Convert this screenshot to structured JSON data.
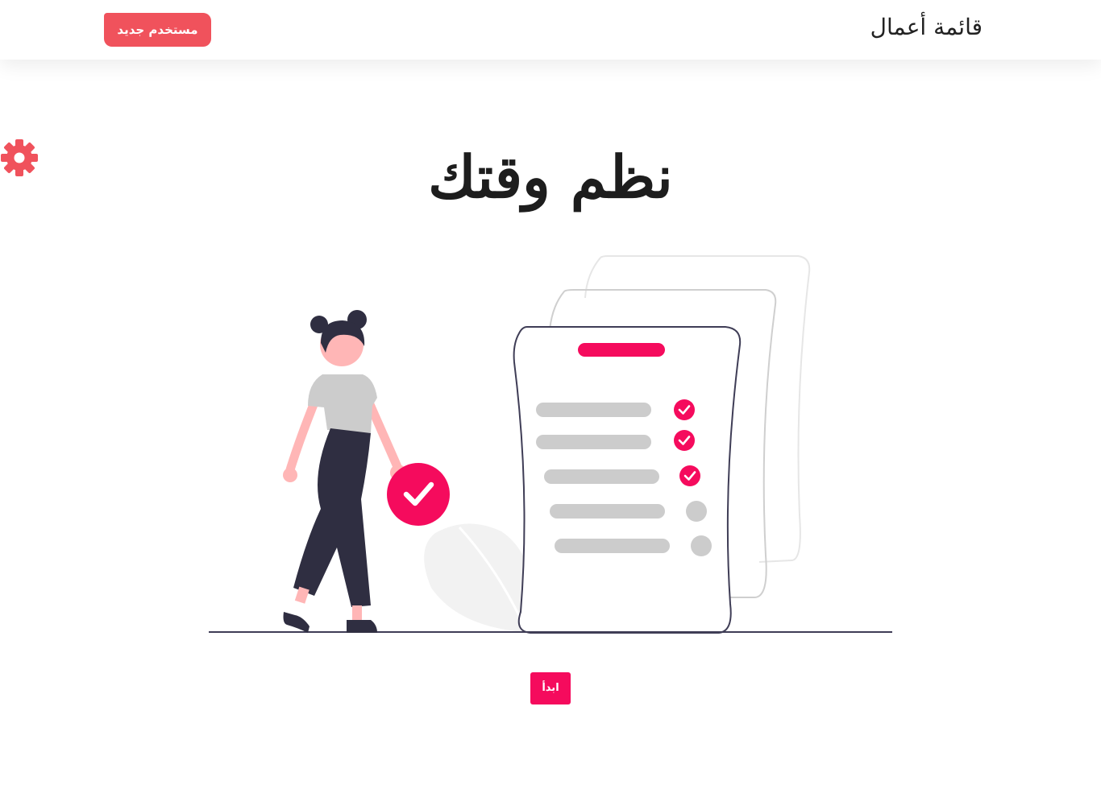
{
  "navbar": {
    "brand": "قائمة أعمال",
    "new_user_button": "مستخدم جديد"
  },
  "settings": {
    "icon": "gear-icon"
  },
  "hero": {
    "title": "نظم وقتك",
    "illustration": {
      "checklist_items": [
        {
          "checked": true
        },
        {
          "checked": true
        },
        {
          "checked": true
        },
        {
          "checked": false
        },
        {
          "checked": false
        }
      ]
    },
    "start_button": "ابدأ"
  },
  "colors": {
    "accent": "#f50b5d",
    "button_red": "#f0525c",
    "dark": "#2f2e41",
    "gray": "#cccccc",
    "skin": "#ffb6b6"
  }
}
